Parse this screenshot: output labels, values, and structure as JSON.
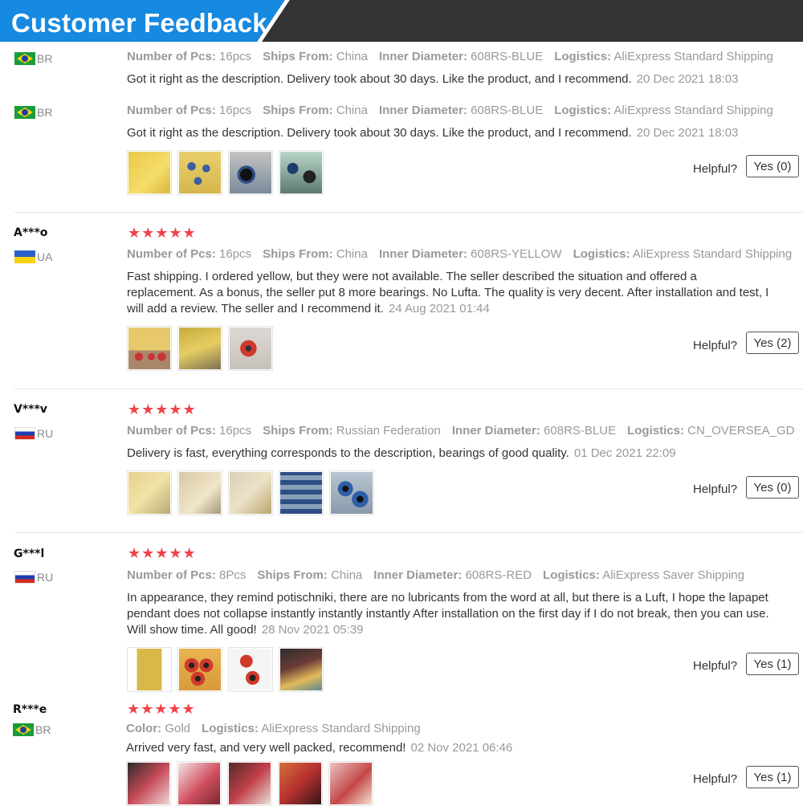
{
  "header": {
    "title": "Customer Feedback"
  },
  "labels": {
    "pcs": "Number of Pcs:",
    "ships": "Ships From:",
    "inner": "Inner Diameter:",
    "logistics": "Logistics:",
    "color": "Color:",
    "helpful": "Helpful?"
  },
  "reviews": [
    {
      "country": "BR",
      "pcs": "16pcs",
      "ships_from": "China",
      "inner_diameter": "608RS-BLUE",
      "logistics": "AliExpress Standard Shipping",
      "text": "Got it right as the description. Delivery took about 30 days. Like the product, and I recommend.",
      "date": "20 Dec 2021 18:03"
    },
    {
      "country": "BR",
      "pcs": "16pcs",
      "ships_from": "China",
      "inner_diameter": "608RS-BLUE",
      "logistics": "AliExpress Standard Shipping",
      "text": "Got it right as the description. Delivery took about 30 days. Like the product, and I recommend.",
      "date": "20 Dec 2021 18:03",
      "helpful_btn": "Yes (0)",
      "thumbs": [
        "yellow-package",
        "blue-bearings-box",
        "dark-bearing",
        "bearing-parts"
      ]
    },
    {
      "name": "A***o",
      "country": "UA",
      "stars": "★★★★★",
      "pcs": "16pcs",
      "ships_from": "China",
      "inner_diameter": "608RS-YELLOW",
      "logistics": "AliExpress Standard Shipping",
      "text": "Fast shipping. I ordered yellow, but they were not available. The seller described the situation and offered a replacement. As a bonus, the seller put 8 more bearings. No Lufta. The quality is very decent. After installation and test, I will add a review. The seller and I recommend it.",
      "date": "24 Aug 2021 01:44",
      "helpful_btn": "Yes (2)",
      "thumbs": [
        "red-bearings-box",
        "yellow-box",
        "red-bearing"
      ]
    },
    {
      "name": "V***v",
      "country": "RU",
      "stars": "★★★★★",
      "pcs": "16pcs",
      "ships_from": "Russian Federation",
      "inner_diameter": "608RS-BLUE",
      "logistics": "CN_OVERSEA_GD",
      "text": "Delivery is fast, everything corresponds to the description, bearings of good quality.",
      "date": "01 Dec 2021 22:09",
      "helpful_btn": "Yes (0)",
      "thumbs": [
        "package-1",
        "package-2",
        "package-3",
        "blue-bearing-rows",
        "blue-bearings"
      ]
    },
    {
      "name": "G***l",
      "country": "RU",
      "stars": "★★★★★",
      "pcs": "8Pcs",
      "ships_from": "China",
      "inner_diameter": "608RS-RED",
      "logistics": "AliExpress Saver Shipping",
      "text": "In appearance, they remind potischniki, there are no lubricants from the word at all, but there is a Luft, I hope the lapapet pendant does not collapse instantly instantly instantly After installation on the first day if I do not break, then you can use. Will show time. All good!",
      "date": "28 Nov 2021 05:39",
      "helpful_btn": "Yes (1)",
      "thumbs": [
        "yellow-package-tall",
        "red-bearing-set",
        "red-bearings-two",
        "mixed-items"
      ]
    },
    {
      "name": "R***e",
      "country": "BR",
      "stars": "★★★★★",
      "color": "Gold",
      "logistics": "AliExpress Standard Shipping",
      "text": "Arrived very fast, and very well packed, recommend!",
      "date": "02 Nov 2021 06:46",
      "helpful_btn": "Yes (1)",
      "thumbs": [
        "red-pink",
        "red-white",
        "red-dark",
        "orange-red",
        "red-pale"
      ]
    }
  ]
}
